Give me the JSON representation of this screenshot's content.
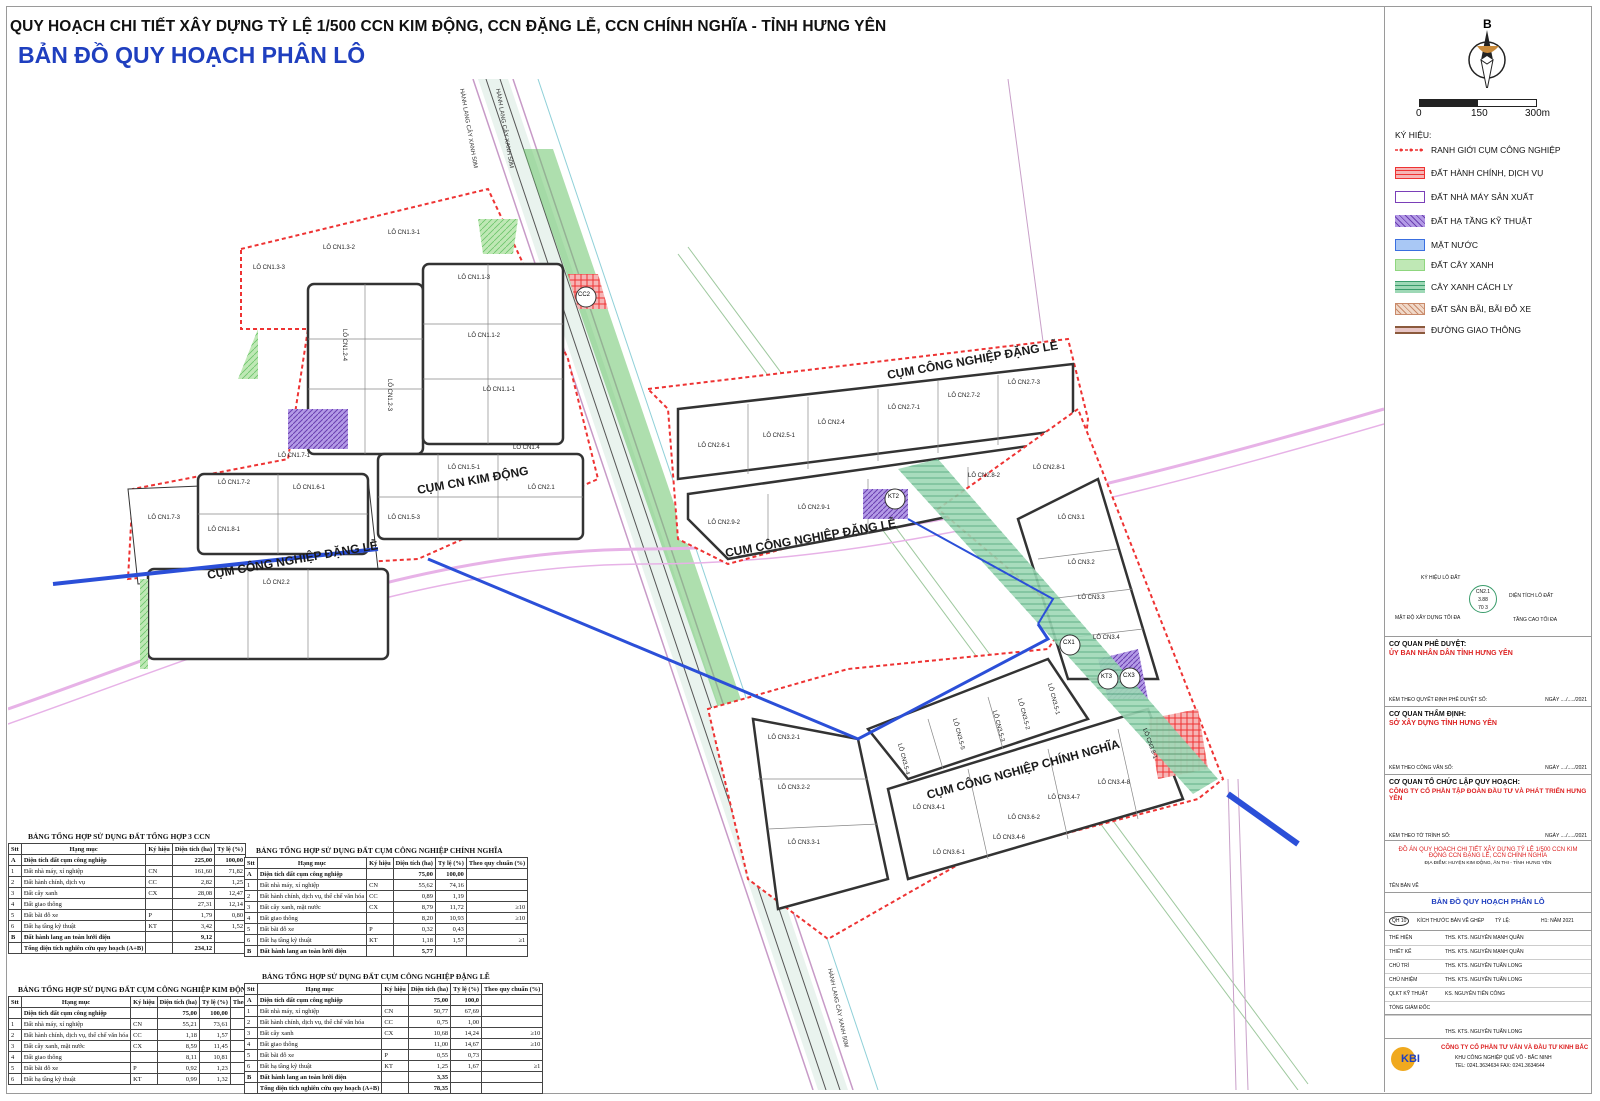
{
  "header": {
    "title": "QUY HOẠCH CHI TIẾT XÂY DỰNG TỶ LỆ 1/500 CCN KIM ĐỘNG, CCN ĐẶNG LỄ, CCN CHÍNH NGHĨA - TỈNH HƯNG YÊN",
    "subtitle": "BẢN ĐỒ QUY HOẠCH PHÂN LÔ"
  },
  "map": {
    "road_label_1": "HÀNH LANG CÂY XANH 50M",
    "road_label_2": "HÀNH LANG CÂY XANH 50M",
    "road_label_3": "HÀNH LANG CÂY XANH 50M",
    "cluster_kimdong": "CỤM CN KIM ĐỘNG",
    "cluster_dangle_1": "CỤM CÔNG NGHIỆP ĐẶNG LỄ",
    "cluster_dangle_2": "CỤM CÔNG NGHIỆP ĐẶNG LỄ",
    "cluster_dangle_3": "CỤM CÔNG NGHIỆP ĐẶNG LỄ",
    "cluster_chinhnghia": "CỤM CÔNG NGHIỆP CHÍNH NGHĨA",
    "lots": [
      "LÔ CN1.3-3",
      "LÔ CN1.3-2",
      "LÔ CN1.3-1",
      "LÔ CN1.2-4",
      "LÔ CN1.2-3",
      "LÔ CN1.1-3",
      "LÔ CN1.1-2",
      "LÔ CN1.1-1",
      "LÔ CN1.4",
      "LÔ CN1.7-1",
      "LÔ CN1.7-2",
      "LÔ CN1.7-3",
      "LÔ CN1.6-1",
      "LÔ CN1.8-1",
      "LÔ CN1.5-1",
      "LÔ CN1.5-3",
      "LÔ CN2.1",
      "LÔ CN2.2",
      "LÔ CN2.6-1",
      "LÔ CN2.5-1",
      "LÔ CN2.4",
      "LÔ CN2.7-1",
      "LÔ CN2.7-2",
      "LÔ CN2.7-3",
      "LÔ CN2.8-2",
      "LÔ CN2.8-1",
      "LÔ CN2.9-1",
      "LÔ CN2.9-2",
      "LÔ CN3.1",
      "LÔ CN3.2",
      "LÔ CN3.3",
      "LÔ CN3.4",
      "LÔ CN3.5-1",
      "LÔ CN3.5-2",
      "LÔ CN3.5-3",
      "LÔ CN3.2-1",
      "LÔ CN3.2-2",
      "LÔ CN3.4-1",
      "LÔ CN3.4-6",
      "LÔ CN3.4-7",
      "LÔ CN3.4-8",
      "LÔ CN3.3-1",
      "LÔ CN3.6-1",
      "LÔ CN3.6-2",
      "LÔ CN3.5-4",
      "LÔ CN3.5-5",
      "LÔ CN3.8-1"
    ],
    "markers": [
      "CC2",
      "CX1",
      "KT2",
      "CX3",
      "KT3"
    ]
  },
  "north_label": "B",
  "scale": {
    "s0": "0",
    "s1": "150",
    "s2": "300m"
  },
  "legend": {
    "title": "KÝ HIỆU:",
    "items": [
      {
        "label": "RANH GIỚI CỤM CÔNG NGHIỆP",
        "color": "#e33"
      },
      {
        "label": "ĐẤT HÀNH CHÍNH, DỊCH VỤ",
        "color": "#e94a4a"
      },
      {
        "label": "ĐẤT NHÀ MÁY SẢN XUẤT",
        "color": "#7a3fb8"
      },
      {
        "label": "ĐẤT HẠ TẦNG KỸ THUẬT",
        "color": "#8a5fd0"
      },
      {
        "label": "MẶT NƯỚC",
        "color": "#3a6fe0"
      },
      {
        "label": "ĐẤT CÂY XANH",
        "color": "#8fd67f"
      },
      {
        "label": "CÂY XANH CÁCH LY",
        "color": "#4fb57a"
      },
      {
        "label": "ĐẤT SÂN BÃI, BÃI ĐỖ XE",
        "color": "#c98a6a"
      },
      {
        "label": "ĐƯỜNG GIAO THÔNG",
        "color": "#8b5a3c"
      }
    ]
  },
  "lot_key": {
    "k1": "KÝ HIỆU LÔ ĐẤT",
    "k2": "DIỆN TÍCH LÔ ĐẤT",
    "k3": "MẬT ĐỘ XÂY DỰNG TỐI ĐA",
    "k4": "TẦNG CAO TỐI ĐA",
    "code": "CN2.1",
    "area": "3.88",
    "dens": "70",
    "floors": "3"
  },
  "title_block": {
    "approve_label": "CƠ QUAN PHÊ DUYỆT:",
    "approve": "ỦY BAN NHÂN DÂN TỈNH HƯNG YÊN",
    "approve_note": "KÈM THEO QUYẾT ĐỊNH PHÊ DUYỆT SỐ:",
    "approve_date": "NGÀY ..../...../2021",
    "appraise_label": "CƠ QUAN THẨM ĐỊNH:",
    "appraise": "SỞ XÂY DỰNG TỈNH HƯNG YÊN",
    "appraise_note": "KÈM THEO CÔNG VĂN SỐ:",
    "appraise_date": "NGÀY ..../...../2021",
    "org_label": "CƠ QUAN TỔ CHỨC LẬP QUY HOẠCH:",
    "org": "CÔNG TY CỔ PHẦN TẬP ĐOÀN ĐẦU TƯ VÀ PHÁT TRIỂN HƯNG YÊN",
    "org_note": "KÈM THEO TỜ TRÌNH SỐ:",
    "org_date": "NGÀY ..../...../2021",
    "project": "ĐỒ ÁN QUY HOẠCH CHI TIẾT XÂY DỰNG TỶ LỆ 1/500 CCN KIM ĐỘNG CCN ĐẶNG LỄ, CCN CHÍNH NGHĨA",
    "location": "ĐỊA ĐIỂM: HUYỆN KIM ĐỘNG, ÂN THI - TỈNH HƯNG YÊN",
    "sheet_label": "TÊN BẢN VẼ",
    "sheet": "BẢN ĐỒ QUY HOẠCH PHÂN LÔ",
    "size_label": "KÍCH THƯỚC BẢN VẼ GHÉP",
    "scale_label": "TỶ LỆ:",
    "year": "H1: NĂM 2021",
    "sheet_no": "QH 10",
    "roles": [
      {
        "role": "THỂ HIỆN",
        "name": "THS. KTS. NGUYỄN MẠNH QUÂN"
      },
      {
        "role": "THIẾT KẾ",
        "name": "THS. KTS. NGUYỄN MẠNH QUÂN"
      },
      {
        "role": "CHỦ TRÌ",
        "name": "THS. KTS. NGUYỄN TUẤN LONG"
      },
      {
        "role": "CHỦ NHIỆM",
        "name": "THS. KTS. NGUYỄN TUẤN LONG"
      },
      {
        "role": "QLKT KỸ THUẬT",
        "name": "KS. NGUYỄN TIẾN CÔNG"
      },
      {
        "role": "TỔNG GIÁM ĐỐC",
        "name": ""
      }
    ],
    "signer": "THS. KTS. NGUYỄN TUẤN LONG",
    "company": "CÔNG TY CỔ PHẦN TƯ VẤN VÀ ĐẦU TƯ KINH BẮC",
    "company_addr": "KHU CÔNG NGHIỆP QUẾ VÕ - BẮC NINH",
    "company_tel": "TEL: 0241.3634634     FAX: 0241.3634644",
    "logo": "KBI"
  },
  "tables": {
    "t3": {
      "caption": "BẢNG TỔNG HỢP SỬ DỤNG ĐẤT TỔNG HỢP 3 CCN",
      "head": [
        "Stt",
        "Hạng mục",
        "Ký hiệu",
        "Diện tích (ha)",
        "Tỷ lệ (%)"
      ],
      "rows": [
        [
          "A",
          "Diện tích đất cụm công nghiệp",
          "",
          "225,00",
          "100,00"
        ],
        [
          "1",
          "Đất nhà máy, xí nghiệp",
          "CN",
          "161,60",
          "71,82"
        ],
        [
          "2",
          "Đất hành chính, dịch vụ",
          "CC",
          "2,82",
          "1,25"
        ],
        [
          "3",
          "Đất cây xanh",
          "CX",
          "28,08",
          "12,47"
        ],
        [
          "4",
          "Đất giao thông",
          "",
          "27,31",
          "12,14"
        ],
        [
          "5",
          "Đất bãi đỗ xe",
          "P",
          "1,79",
          "0,80"
        ],
        [
          "6",
          "Đất hạ tầng kỹ thuật",
          "KT",
          "3,42",
          "1,52"
        ],
        [
          "B",
          "Đất hành lang an toàn lưới điện",
          "",
          "9,12",
          ""
        ],
        [
          "",
          "Tổng diện tích nghiên cứu quy hoạch (A+B)",
          "",
          "234,12",
          ""
        ]
      ]
    },
    "tk": {
      "caption": "BẢNG TỔNG HỢP SỬ DỤNG ĐẤT CỤM CÔNG NGHIỆP KIM ĐỘNG",
      "head": [
        "Stt",
        "Hạng mục",
        "Ký hiệu",
        "Diện tích (ha)",
        "Tỷ lệ (%)",
        "Theo quy chuẩn (%)"
      ],
      "rows": [
        [
          "",
          "Diện tích đất cụm công nghiệp",
          "",
          "75,00",
          "100,00",
          ""
        ],
        [
          "1",
          "Đất nhà máy, xí nghiệp",
          "CN",
          "55,21",
          "73,61",
          ""
        ],
        [
          "2",
          "Đất hành chính, dịch vụ, thể chế văn hóa",
          "CC",
          "1,18",
          "1,57",
          ""
        ],
        [
          "3",
          "Đất cây xanh, mặt nước",
          "CX",
          "8,59",
          "11,45",
          "≥10"
        ],
        [
          "4",
          "Đất giao thông",
          "",
          "8,11",
          "10,81",
          "≥10"
        ],
        [
          "5",
          "Đất bãi đỗ xe",
          "P",
          "0,92",
          "1,23",
          ""
        ],
        [
          "6",
          "Đất hạ tầng kỹ thuật",
          "KT",
          "0,99",
          "1,32",
          "≥1"
        ]
      ]
    },
    "tc": {
      "caption": "BẢNG TỔNG HỢP SỬ DỤNG ĐẤT CỤM CÔNG NGHIỆP CHÍNH NGHĨA",
      "head": [
        "Stt",
        "Hạng mục",
        "Ký hiệu",
        "Diện tích (ha)",
        "Tỷ lệ (%)",
        "Theo quy chuẩn (%)"
      ],
      "rows": [
        [
          "A",
          "Diện tích đất cụm công nghiệp",
          "",
          "75,00",
          "100,00",
          ""
        ],
        [
          "1",
          "Đất nhà máy, xí nghiệp",
          "CN",
          "55,62",
          "74,16",
          ""
        ],
        [
          "2",
          "Đất hành chính, dịch vụ, thể chế văn hóa",
          "CC",
          "0,89",
          "1,19",
          ""
        ],
        [
          "3",
          "Đất cây xanh, mặt nước",
          "CX",
          "8,79",
          "11,72",
          "≥10"
        ],
        [
          "4",
          "Đất giao thông",
          "",
          "8,20",
          "10,93",
          "≥10"
        ],
        [
          "5",
          "Đất bãi đỗ xe",
          "P",
          "0,32",
          "0,43",
          ""
        ],
        [
          "6",
          "Đất hạ tầng kỹ thuật",
          "KT",
          "1,18",
          "1,57",
          "≥1"
        ],
        [
          "B",
          "Đất hành lang an toàn lưới điện",
          "",
          "5,77",
          "",
          ""
        ]
      ]
    },
    "td": {
      "caption": "BẢNG TỔNG HỢP SỬ DỤNG ĐẤT CỤM CÔNG NGHIỆP ĐẶNG LỄ",
      "head": [
        "Stt",
        "Hạng mục",
        "Ký hiệu",
        "Diện tích (ha)",
        "Tỷ lệ (%)",
        "Theo quy chuẩn (%)"
      ],
      "rows": [
        [
          "A",
          "Diện tích đất cụm công nghiệp",
          "",
          "75,00",
          "100,0",
          ""
        ],
        [
          "1",
          "Đất nhà máy, xí nghiệp",
          "CN",
          "50,77",
          "67,69",
          ""
        ],
        [
          "2",
          "Đất hành chính, dịch vụ, thể chế văn hóa",
          "CC",
          "0,75",
          "1,00",
          ""
        ],
        [
          "3",
          "Đất cây xanh",
          "CX",
          "10,68",
          "14,24",
          "≥10"
        ],
        [
          "4",
          "Đất giao thông",
          "",
          "11,00",
          "14,67",
          "≥10"
        ],
        [
          "5",
          "Đất bãi đỗ xe",
          "P",
          "0,55",
          "0,73",
          ""
        ],
        [
          "6",
          "Đất hạ tầng kỹ thuật",
          "KT",
          "1,25",
          "1,67",
          "≥1"
        ],
        [
          "B",
          "Đất hành lang an toàn lưới điện",
          "",
          "3,35",
          "",
          ""
        ],
        [
          "",
          "Tổng diện tích nghiên cứu quy hoạch (A+B)",
          "",
          "78,35",
          "",
          ""
        ]
      ]
    }
  }
}
